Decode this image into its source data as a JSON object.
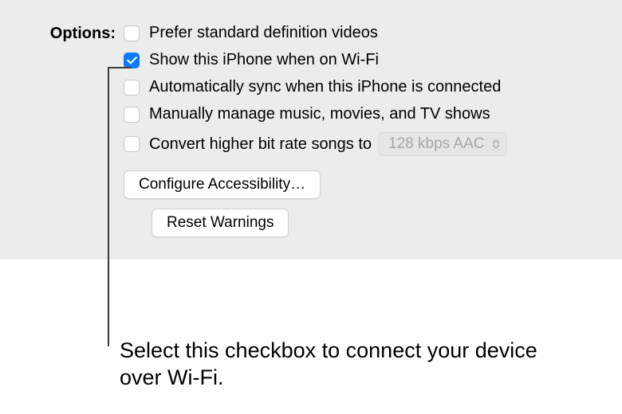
{
  "options": {
    "section_label": "Options:",
    "items": [
      {
        "label": "Prefer standard definition videos",
        "checked": false
      },
      {
        "label": "Show this iPhone when on Wi-Fi",
        "checked": true
      },
      {
        "label": "Automatically sync when this iPhone is connected",
        "checked": false
      },
      {
        "label": "Manually manage music, movies, and TV shows",
        "checked": false
      },
      {
        "label": "Convert higher bit rate songs to",
        "checked": false
      }
    ],
    "bitrate_dropdown": {
      "selected": "128 kbps AAC"
    },
    "buttons": {
      "configure_accessibility": "Configure Accessibility…",
      "reset_warnings": "Reset Warnings"
    }
  },
  "callout": {
    "text": "Select this checkbox to connect your device over Wi-Fi."
  }
}
